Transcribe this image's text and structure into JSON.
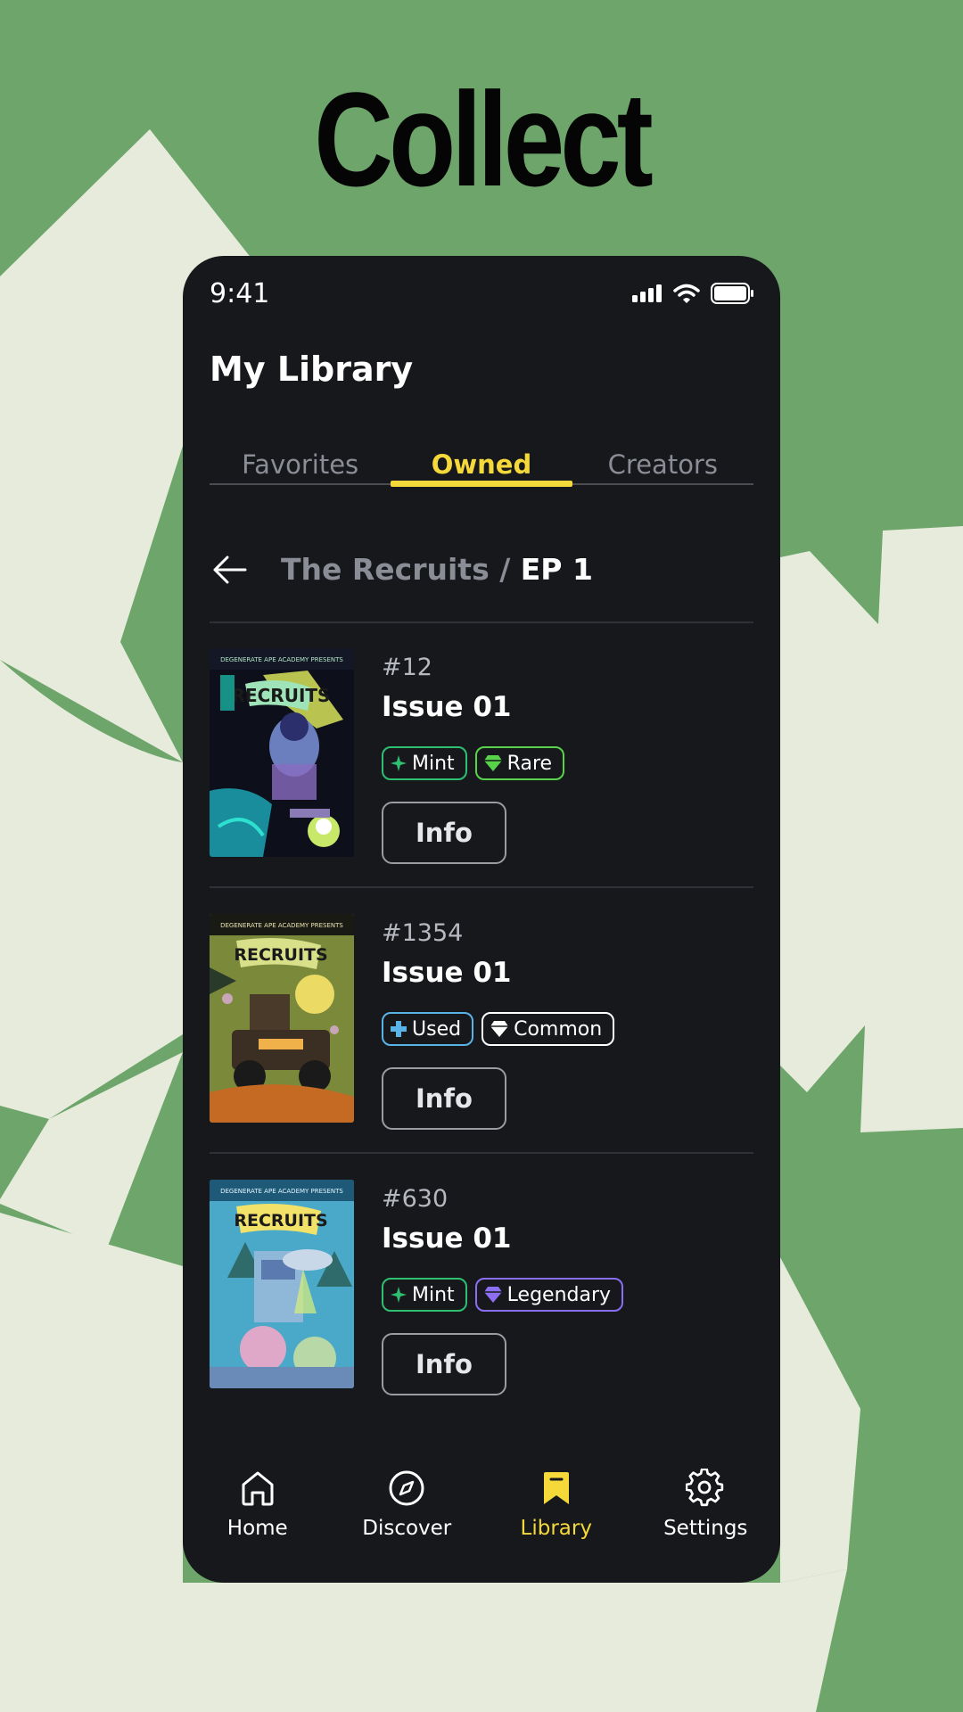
{
  "headline": "Collect",
  "status": {
    "time": "9:41"
  },
  "page_title": "My Library",
  "tabs": [
    {
      "label": "Favorites",
      "active": false
    },
    {
      "label": "Owned",
      "active": true
    },
    {
      "label": "Creators",
      "active": false
    }
  ],
  "breadcrumb": {
    "series": "The Recruits / ",
    "episode": "EP 1"
  },
  "items": [
    {
      "number": "#12",
      "title": "Issue 01",
      "badges": [
        {
          "label": "Mint",
          "icon": "sparkle-icon",
          "color": "#2fbf71"
        },
        {
          "label": "Rare",
          "icon": "gem-icon",
          "color": "#57d34a"
        }
      ],
      "button": "Info"
    },
    {
      "number": "#1354",
      "title": "Issue 01",
      "badges": [
        {
          "label": "Used",
          "icon": "plus-icon",
          "color": "#5ab3e6"
        },
        {
          "label": "Common",
          "icon": "gem-icon",
          "color": "#ffffff"
        }
      ],
      "button": "Info"
    },
    {
      "number": "#630",
      "title": "Issue 01",
      "badges": [
        {
          "label": "Mint",
          "icon": "sparkle-icon",
          "color": "#2fbf71"
        },
        {
          "label": "Legendary",
          "icon": "gem-icon",
          "color": "#8b6ff0"
        }
      ],
      "button": "Info"
    }
  ],
  "nav": [
    {
      "label": "Home",
      "icon": "home-icon",
      "active": false
    },
    {
      "label": "Discover",
      "icon": "compass-icon",
      "active": false
    },
    {
      "label": "Library",
      "icon": "bookmark-icon",
      "active": true
    },
    {
      "label": "Settings",
      "icon": "gear-icon",
      "active": false
    }
  ],
  "colors": {
    "accent": "#f5d93a",
    "background": "#6ea56b",
    "shape": "#e6ebdc",
    "panel": "#17181c"
  }
}
